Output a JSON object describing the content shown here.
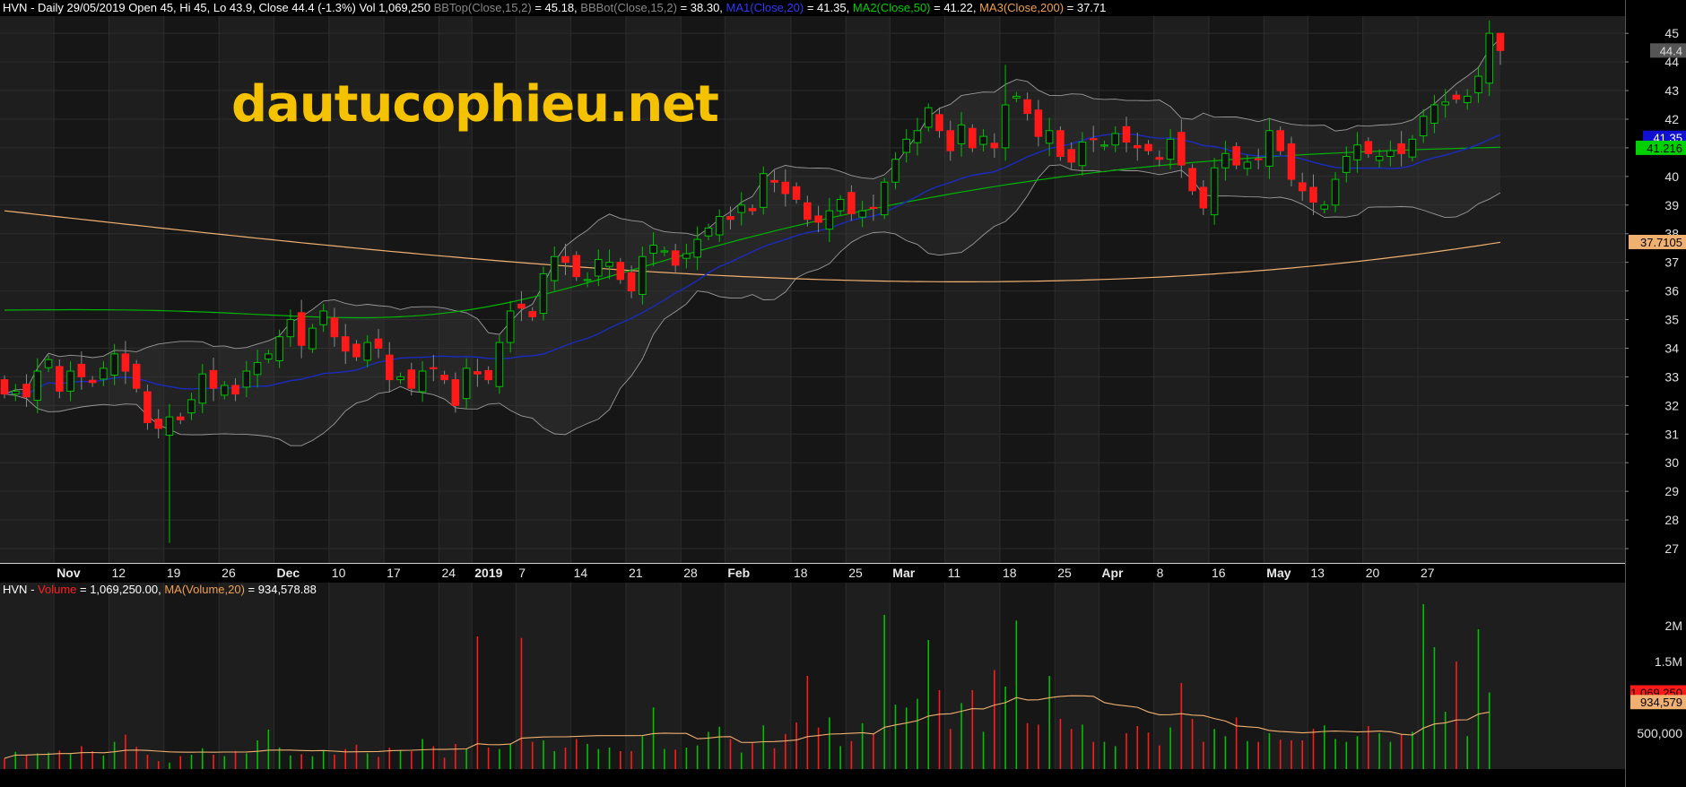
{
  "header": {
    "symbol": "HVN",
    "summary": " - Daily 29/05/2019 Open 45, Hi 45, Lo 43.9, Close 44.4 (-1.3%) Vol 1,069,250 ",
    "bbtop_label": "BBTop(Close,15,2)",
    "bbtop_value": " = 45.18, ",
    "bbbot_label": "BBBot(Close,15,2)",
    "bbbot_value": " = 38.30, ",
    "ma1_label": "MA1(Close,20)",
    "ma1_value": " = 41.35, ",
    "ma2_label": "MA2(Close,50)",
    "ma2_value": " = 41.22, ",
    "ma3_label": "MA3(Close,200)",
    "ma3_value": " = 37.71"
  },
  "volume_header": {
    "symbol": "HVN",
    "sep": " - ",
    "volume_label": "Volume",
    "volume_value": " = 1,069,250.00, ",
    "ma_label": "MA(Volume,20)",
    "ma_value": " = 934,578.88"
  },
  "watermark": "dautucophieu.net",
  "colors": {
    "up": "#00c000",
    "down": "#ff1a1a",
    "ma1": "#1a2bbf",
    "ma2": "#00b400",
    "ma3": "#f0b070",
    "bb": "#9a9a9a",
    "watermark": "#f5c200"
  },
  "chart_data": {
    "type": "candlestick",
    "ylim": [
      26.5,
      45.6
    ],
    "y_ticks": [
      "27",
      "28",
      "29",
      "30",
      "31",
      "32",
      "33",
      "34",
      "35",
      "36",
      "37",
      "38",
      "39",
      "40",
      "41",
      "42",
      "43",
      "44",
      "45"
    ],
    "x_tick_labels": [
      {
        "label": "Nov",
        "i": 5,
        "bold": true
      },
      {
        "label": "12",
        "i": 10
      },
      {
        "label": "19",
        "i": 15
      },
      {
        "label": "26",
        "i": 20
      },
      {
        "label": "Dec",
        "i": 25,
        "bold": true
      },
      {
        "label": "10",
        "i": 30
      },
      {
        "label": "17",
        "i": 35
      },
      {
        "label": "24",
        "i": 40
      },
      {
        "label": "2019",
        "i": 43,
        "bold": true
      },
      {
        "label": "7",
        "i": 47
      },
      {
        "label": "14",
        "i": 52
      },
      {
        "label": "21",
        "i": 57
      },
      {
        "label": "28",
        "i": 62
      },
      {
        "label": "Feb",
        "i": 66,
        "bold": true
      },
      {
        "label": "18",
        "i": 72
      },
      {
        "label": "25",
        "i": 77
      },
      {
        "label": "Mar",
        "i": 81,
        "bold": true
      },
      {
        "label": "11",
        "i": 86
      },
      {
        "label": "18",
        "i": 91
      },
      {
        "label": "25",
        "i": 96
      },
      {
        "label": "Apr",
        "i": 100,
        "bold": true
      },
      {
        "label": "8",
        "i": 105
      },
      {
        "label": "16",
        "i": 110
      },
      {
        "label": "May",
        "i": 115,
        "bold": true
      },
      {
        "label": "13",
        "i": 119
      },
      {
        "label": "20",
        "i": 124
      },
      {
        "label": "27",
        "i": 129
      }
    ],
    "closes": [
      32.4,
      32.5,
      32.3,
      33.2,
      33.6,
      32.5,
      33.2,
      33.0,
      32.8,
      33.3,
      33.8,
      33.2,
      32.6,
      31.4,
      31.2,
      31.6,
      31.5,
      32.2,
      33.1,
      32.6,
      32.7,
      32.4,
      33.2,
      33.5,
      33.8,
      34.4,
      35.0,
      34.1,
      34.7,
      35.3,
      34.4,
      33.9,
      33.7,
      34.2,
      34.0,
      32.9,
      33.0,
      32.6,
      33.2,
      33.3,
      32.9,
      32.0,
      33.3,
      33.1,
      32.9,
      34.2,
      35.3,
      35.4,
      35.1,
      36.6,
      37.2,
      37.0,
      36.5,
      36.4,
      37.1,
      37.0,
      36.4,
      36.0,
      37.2,
      37.6,
      37.4,
      36.9,
      37.3,
      37.8,
      38.2,
      38.6,
      38.5,
      39.0,
      38.8,
      40.1,
      39.8,
      39.4,
      39.2,
      38.5,
      38.4,
      38.8,
      39.2,
      38.7,
      38.8,
      38.9,
      39.8,
      40.6,
      41.3,
      41.6,
      42.4,
      41.6,
      40.9,
      41.8,
      41.0,
      41.4,
      41.0,
      42.5,
      42.8,
      42.2,
      41.4,
      41.6,
      40.7,
      40.5,
      41.2,
      41.3,
      41.1,
      41.5,
      41.2,
      41.0,
      40.9,
      40.6,
      41.3,
      40.4,
      39.5,
      38.9,
      40.3,
      40.8,
      40.4,
      40.5,
      40.6,
      41.6,
      40.9,
      39.9,
      39.5,
      39.1,
      39.0,
      39.9,
      40.7,
      41.1,
      40.8,
      40.7,
      40.9,
      40.8,
      41.3,
      42.1,
      42.5,
      42.6,
      42.7,
      42.8,
      43.5,
      45.0,
      44.4
    ],
    "volume_ylim": [
      0,
      2400000
    ],
    "volume_ticks": [
      {
        "label": "500,000",
        "v": 500000
      },
      {
        "label": "1.5M",
        "v": 1500000
      },
      {
        "label": "2M",
        "v": 2000000
      }
    ],
    "volumes": [
      150000,
      240000,
      200000,
      220000,
      230000,
      260000,
      210000,
      320000,
      250000,
      190000,
      380000,
      480000,
      310000,
      200000,
      110000,
      90000,
      180000,
      200000,
      290000,
      200000,
      180000,
      250000,
      220000,
      400000,
      550000,
      300000,
      190000,
      210000,
      180000,
      250000,
      200000,
      280000,
      340000,
      220000,
      170000,
      300000,
      260000,
      250000,
      420000,
      320000,
      160000,
      350000,
      280000,
      1850000,
      300000,
      280000,
      350000,
      1830000,
      380000,
      400000,
      250000,
      300000,
      420000,
      350000,
      280000,
      300000,
      250000,
      250000,
      460000,
      860000,
      280000,
      270000,
      300000,
      330000,
      520000,
      590000,
      420000,
      230000,
      360000,
      610000,
      290000,
      490000,
      650000,
      1300000,
      580000,
      720000,
      320000,
      390000,
      640000,
      500000,
      2150000,
      900000,
      860000,
      980000,
      1800000,
      1100000,
      560000,
      920000,
      1100000,
      520000,
      1380000,
      1150000,
      2070000,
      640000,
      620000,
      1300000,
      700000,
      560000,
      620000,
      380000,
      380000,
      320000,
      500000,
      600000,
      510000,
      330000,
      580000,
      1200000,
      700000,
      380000,
      560000,
      460000,
      720000,
      390000,
      380000,
      500000,
      410000,
      400000,
      400000,
      560000,
      610000,
      420000,
      380000,
      460000,
      600000,
      500000,
      380000,
      480000,
      520000,
      2300000,
      1700000,
      800000,
      1500000,
      460000,
      1950000,
      1069250
    ],
    "volume_ma_last": 934578.88,
    "price_labels": [
      {
        "text": "44.4",
        "value": 44.4,
        "bg": "#555555",
        "fg": "#dddddd"
      },
      {
        "text": "41.35",
        "value": 41.35,
        "bg": "#1010d0",
        "fg": "#ffffff"
      },
      {
        "text": "41.216",
        "value": 41.0,
        "bg": "#00d000",
        "fg": "#000000"
      },
      {
        "text": "37.7105",
        "value": 37.71,
        "bg": "#f0b070",
        "fg": "#000000"
      }
    ],
    "volume_labels": [
      {
        "text": "1,069,250",
        "value": 1069250,
        "bg": "#ff1a1a",
        "fg": "#000000"
      },
      {
        "text": "934,579",
        "value": 934579,
        "bg": "#f0b070",
        "fg": "#000000"
      }
    ]
  }
}
